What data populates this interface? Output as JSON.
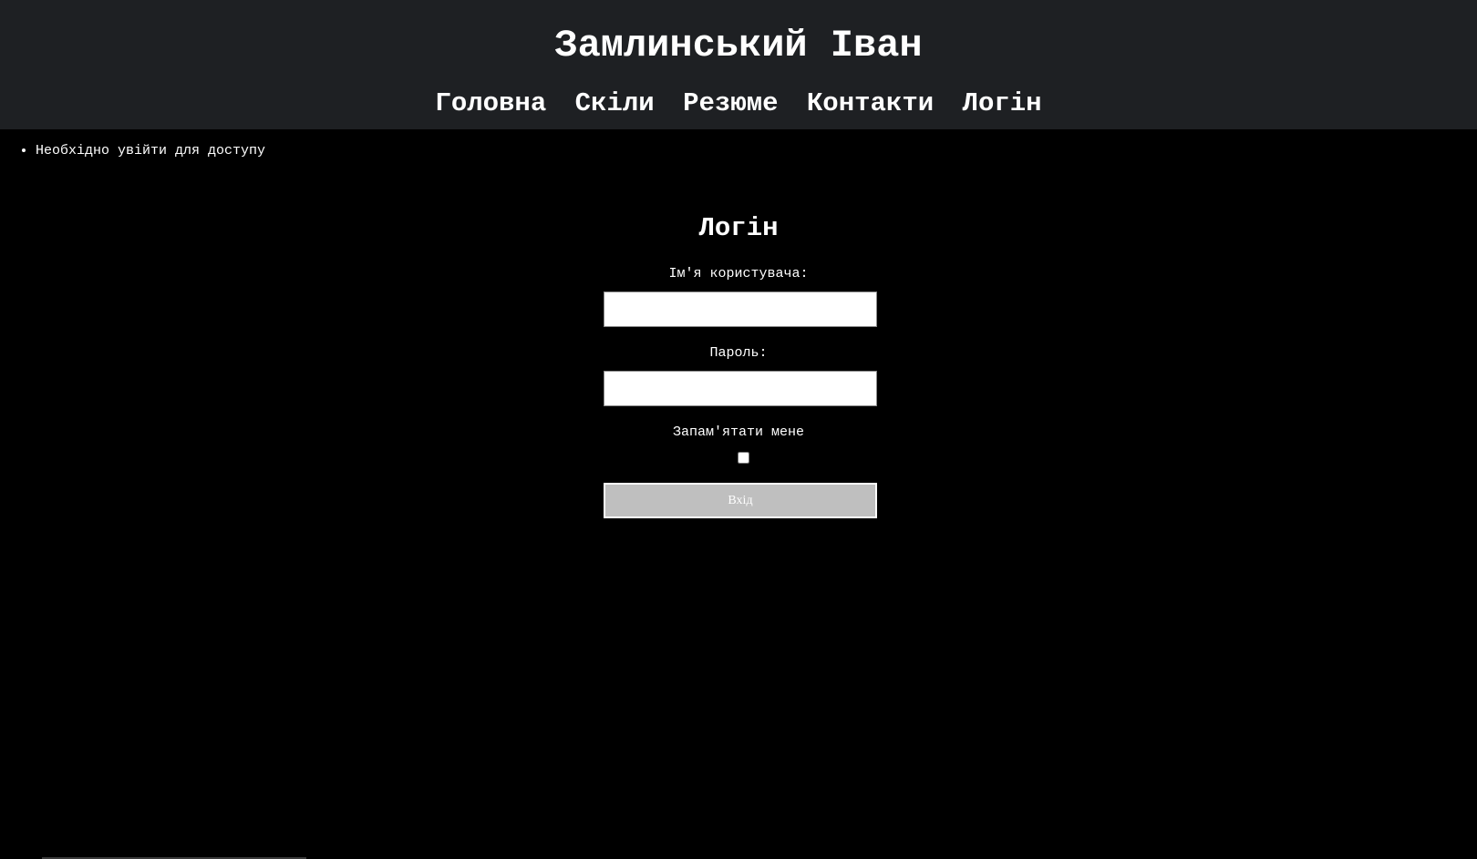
{
  "header": {
    "site_title": "Замлинський Іван",
    "nav": [
      "Головна",
      "Скіли",
      "Резюме",
      "Контакти",
      "Логін"
    ]
  },
  "messages": [
    "Необхідно увійти для доступу"
  ],
  "login_form": {
    "title": "Логін",
    "username_label": "Ім'я користувача:",
    "username_value": "",
    "password_label": "Пароль:",
    "password_value": "",
    "remember_label": "Запам'ятати мене",
    "remember_checked": false,
    "submit_label": "Вхід"
  },
  "colors": {
    "page_background": "#000000",
    "header_background": "#1e2023",
    "text": "#ffffff",
    "button_background": "#bfbfbf"
  }
}
